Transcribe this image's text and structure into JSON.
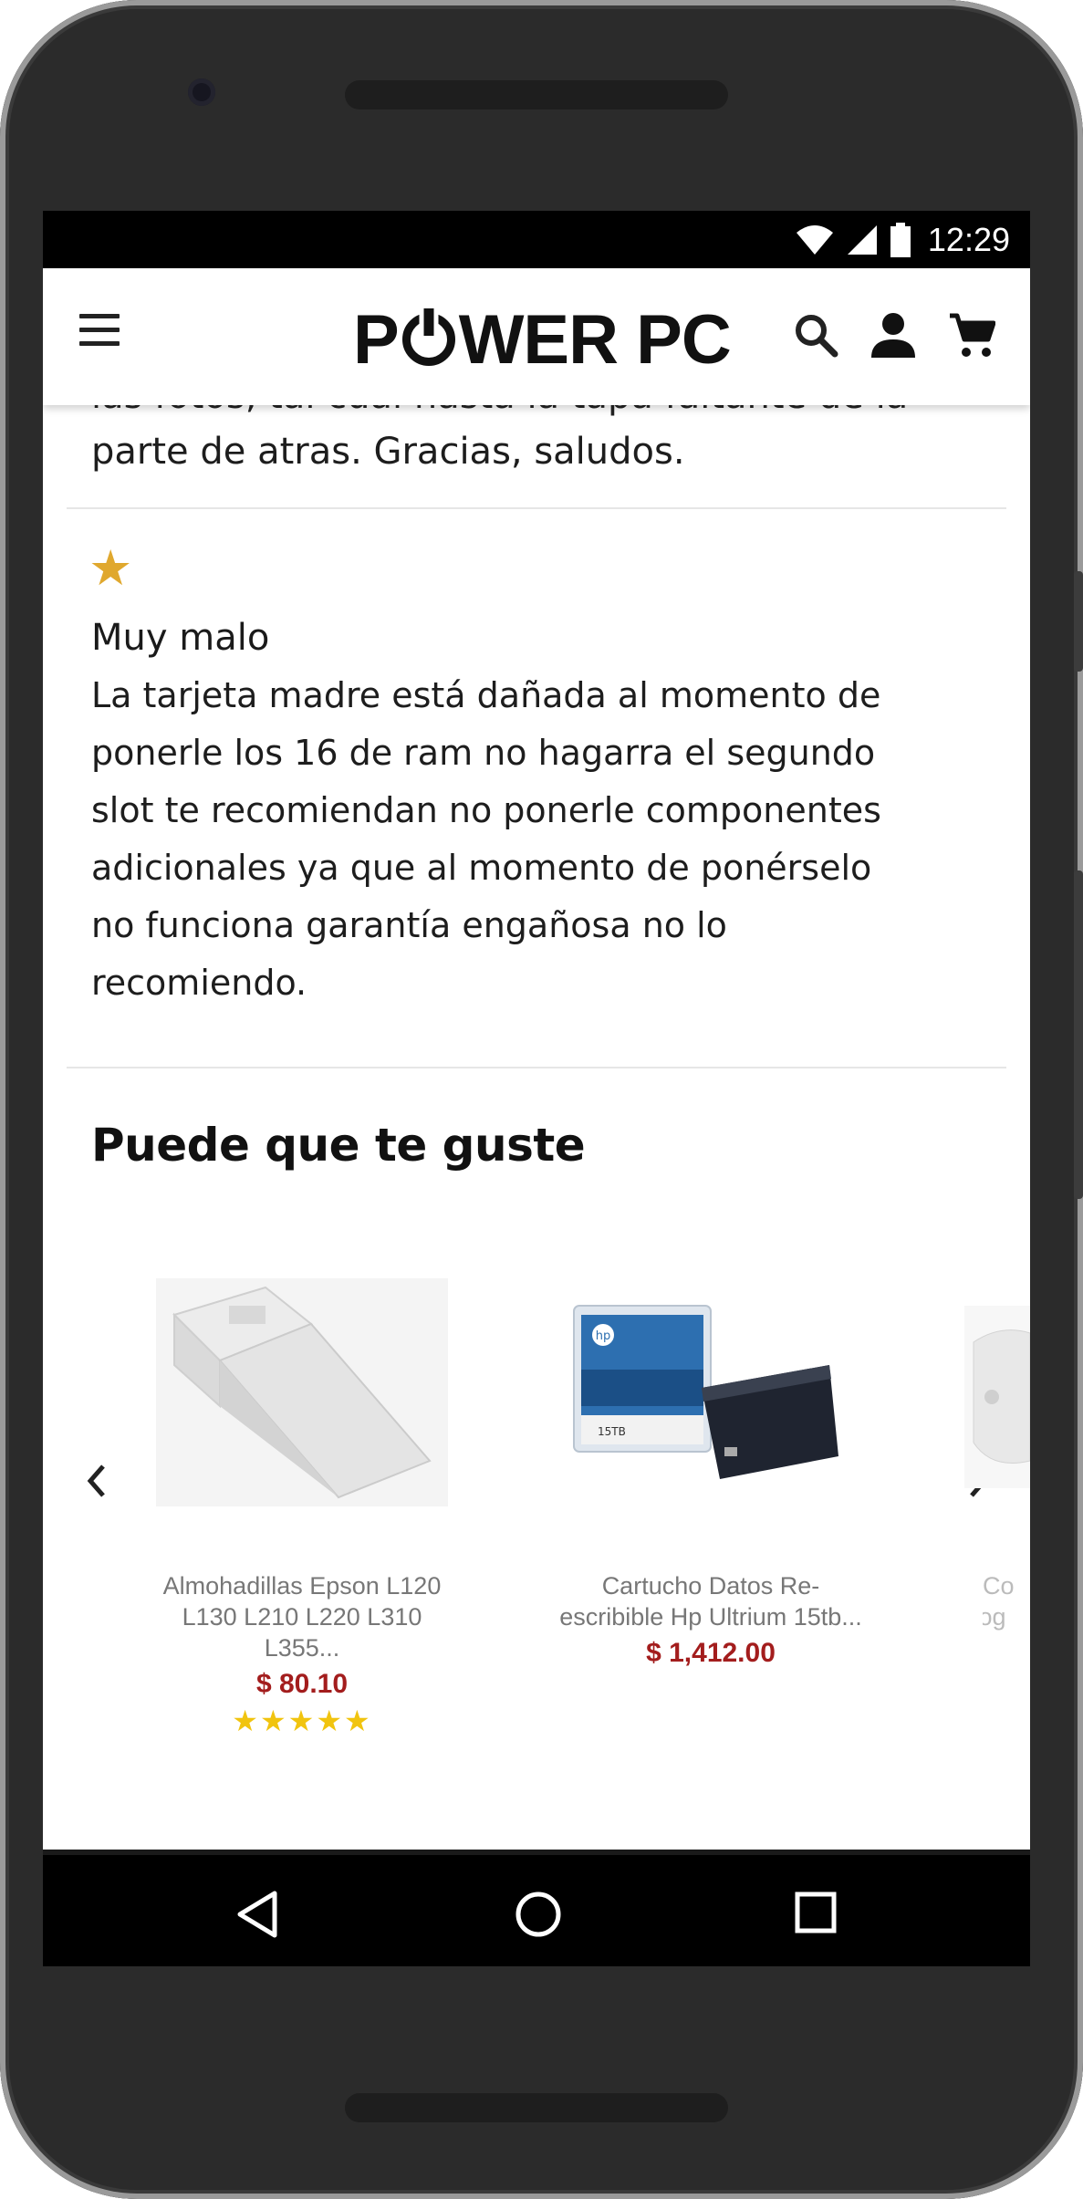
{
  "status_bar": {
    "time": "12:29"
  },
  "header": {
    "logo_left": "P",
    "logo_right": "WER PC",
    "menu_icon": "hamburger-icon",
    "search_icon": "search-icon",
    "account_icon": "person-icon",
    "cart_icon": "cart-icon"
  },
  "reviews": {
    "partial_text_line1": "las fotos, tal cual hasta la tapa faltante de la",
    "partial_text_line2": "parte de atras. Gracias, saludos.",
    "review2": {
      "rating": 1,
      "star": "★",
      "title": "Muy malo",
      "body_lines": [
        "La tarjeta madre está dañada al momento de",
        "ponerle los 16 de ram no hagarra el segundo",
        "slot te recomiendan no ponerle componentes",
        "adicionales ya que al momento de ponérselo",
        "no funciona garantía engañosa no lo",
        "recomiendo."
      ]
    }
  },
  "recommendations": {
    "title": "Puede que te guste",
    "products": [
      {
        "name_line1": "Almohadillas Epson L120",
        "name_line2": "L130 L210 L220 L310 L355...",
        "price": "$ 80.10",
        "rating_stars": "★★★★★",
        "rating": 5
      },
      {
        "name_line1": "Cartucho Datos Re-",
        "name_line2": "escribible Hp Ultrium 15tb...",
        "price": "$ 1,412.00"
      },
      {
        "name_line1": "Co",
        "name_line2": "Yog"
      }
    ],
    "hp_label": "15TB",
    "hp_logo": "hp"
  },
  "nav": {
    "back_icon": "back-triangle-icon",
    "home_icon": "home-circle-icon",
    "recents_icon": "recents-square-icon"
  },
  "colors": {
    "price": "#a31d1d",
    "star": "#e0a82e",
    "rating_stars": "#f1c40f"
  }
}
